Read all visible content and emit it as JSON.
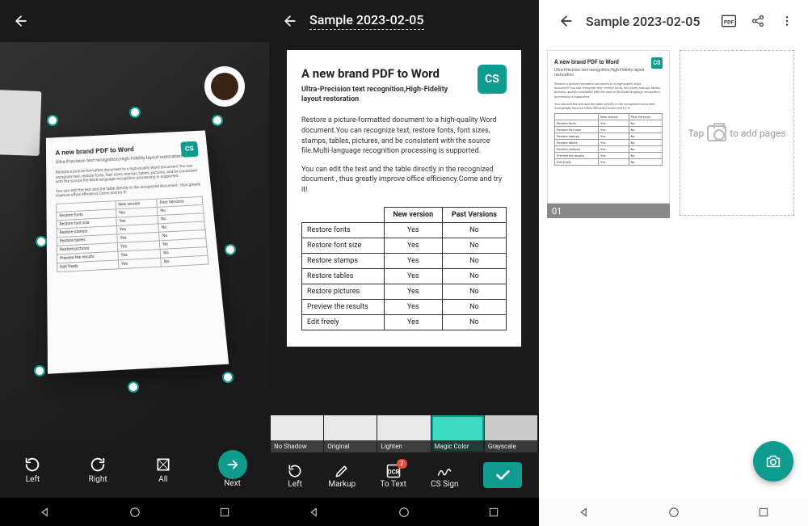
{
  "header": {
    "title": "Sample 2023-02-05"
  },
  "document": {
    "logo_text": "CS",
    "title": "A new brand PDF to Word",
    "subtitle": "Ultra-Precision text recognition,High-Fidelity layout restoration",
    "para1": "Restore a picture-formatted document to a high-quality Word document.You can recognize text, restore fonts, font sizes, stamps, tables, pictures, and be consistent with the source file.Multi-language recognition processing is supported.",
    "para2": "You can edit the text and the table directly in the recognized document , thus greatly improve office efficiency.Come and try it!",
    "table": {
      "col_new": "New version",
      "col_past": "Past Versions",
      "rows": [
        {
          "feat": "Restore fonts",
          "new": "Yes",
          "past": "No"
        },
        {
          "feat": "Restore font size",
          "new": "Yes",
          "past": "No"
        },
        {
          "feat": "Restore stamps",
          "new": "Yes",
          "past": "No"
        },
        {
          "feat": "Restore tables",
          "new": "Yes",
          "past": "No"
        },
        {
          "feat": "Restore pictures",
          "new": "Yes",
          "past": "No"
        },
        {
          "feat": "Preview the results",
          "new": "Yes",
          "past": "No"
        },
        {
          "feat": "Edit freely",
          "new": "Yes",
          "past": "No"
        }
      ]
    }
  },
  "panel1": {
    "toolbar": {
      "left": "Left",
      "right": "Right",
      "all": "All",
      "next": "Next"
    }
  },
  "panel2": {
    "filters": {
      "noshadow": "No Shadow",
      "original": "Original",
      "lighten": "Lighten",
      "magic": "Magic Color",
      "grayscale": "Grayscale"
    },
    "toolbar": {
      "left": "Left",
      "markup": "Markup",
      "totext": "To Text",
      "totext_badge": "2",
      "cssign": "CS Sign"
    }
  },
  "panel3": {
    "thumb_number": "01",
    "add_prefix": "Tap",
    "add_suffix": "to add pages"
  }
}
